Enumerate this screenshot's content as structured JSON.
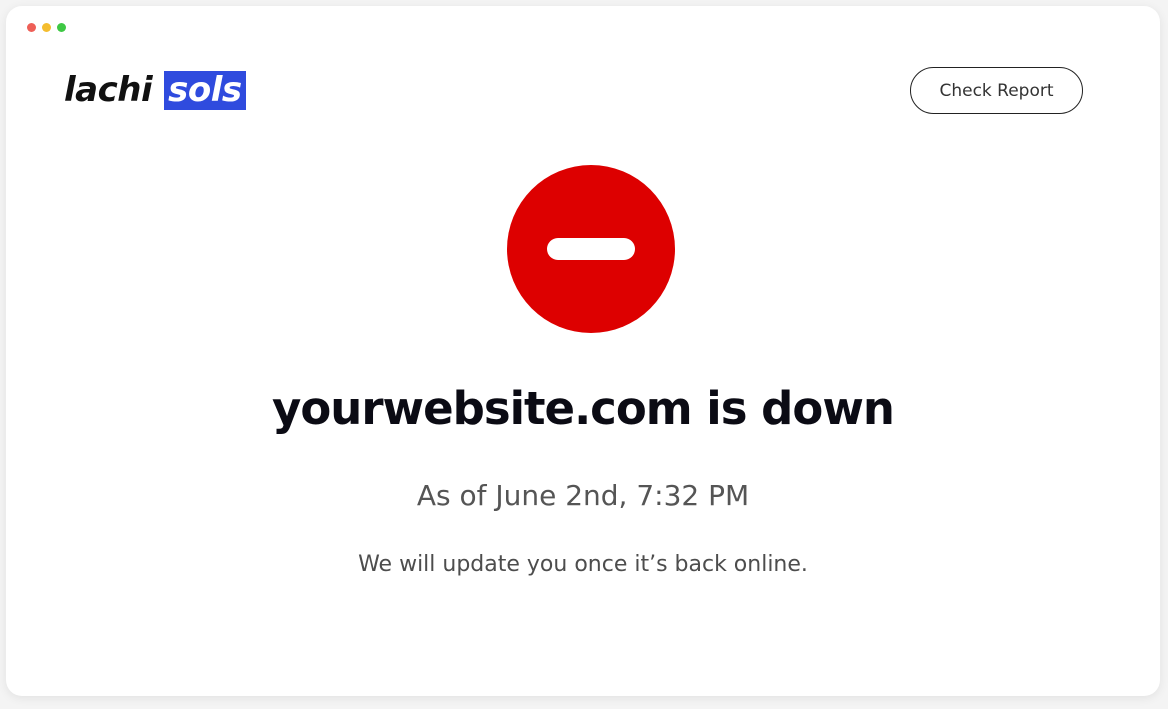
{
  "window": {
    "controls": [
      {
        "name": "close-dot",
        "color": "#ee5f57"
      },
      {
        "name": "minimize-dot",
        "color": "#f4bd2f"
      },
      {
        "name": "maximize-dot",
        "color": "#3ec844"
      }
    ]
  },
  "header": {
    "logo": {
      "part1": "lachi",
      "part2": "sols",
      "highlight_color": "#2f4bde"
    },
    "check_report_label": "Check Report"
  },
  "status": {
    "icon": "no-entry-icon",
    "icon_color": "#dd0000",
    "headline": "yourwebsite.com is down",
    "timestamp": "As of June 2nd, 7:32 PM",
    "message": "We will update you once it’s back online."
  }
}
